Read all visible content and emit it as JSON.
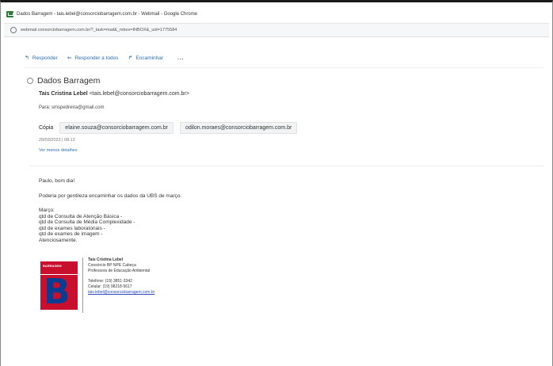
{
  "window": {
    "title": "Dados Barragem - tais.lebel@consorciobarragem.com.br - Webmail - Google Chrome",
    "url": "webmail.consorciobarragem.com.br/?_task=mail&_mbox=INBOX&_uid=1775584"
  },
  "toolbar": {
    "reply": "Responder",
    "reply_all": "Responder a todos",
    "forward": "Encaminhar",
    "more": "..."
  },
  "email": {
    "subject": "Dados Barragem",
    "sender_name": "Tais Cristina Lebel",
    "sender_email": "<tais.lebel@consorciobarragem.com.br>",
    "to": "Para: smspedreira@gmail.com",
    "cc_label": "Cópia",
    "cc": [
      "elaine.souza@consorciobarragem.com.br",
      "odilon.moraes@consorciobarragem.com.br"
    ],
    "date": "29/03/2023 | 08:12",
    "details_link": "Ver menos detalhes",
    "greeting": "Paulo, bom dia!",
    "request": "Poderia por gentileza encaminhar os dados da UBS de março.",
    "list": [
      "Março:",
      "qtd de Consulta de Atenção Básica -",
      "qtd de Consulta de Média Complexidade -",
      "qtd de exames laboratoriais -",
      "qtd de exames de imagem -",
      "Atenciosamente."
    ]
  },
  "signature": {
    "logo_text": "BARRAGEM",
    "logo_letter": "B",
    "name": "Tais Cristina Lebel",
    "company": "Consórcio BP NPE Cabeça",
    "role": "Professora de Educação Ambiental",
    "phone": "Telefone: (19) 3851-3342",
    "mobile": "Celular: (19) 98218-5617",
    "email": "tais.lebel@consorciobarragem.com.br"
  }
}
